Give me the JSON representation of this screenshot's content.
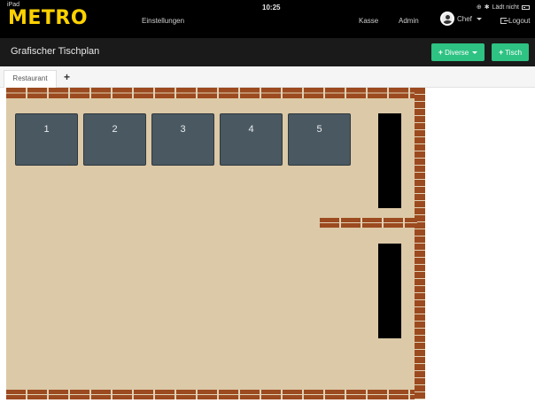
{
  "status": {
    "device": "iPad",
    "time": "10:25",
    "battery_text": "Lädt nicht"
  },
  "nav": {
    "logo": "METRO",
    "settings": "Einstellungen",
    "kasse": "Kasse",
    "admin": "Admin",
    "user": "Chef",
    "logout": "Logout"
  },
  "header": {
    "title": "Grafischer Tischplan",
    "diverse_label": "Diverse",
    "tisch_label": "Tisch"
  },
  "tabs": {
    "active": "Restaurant",
    "add": "+"
  },
  "tables": [
    "1",
    "2",
    "3",
    "4",
    "5"
  ],
  "colors": {
    "logo": "#ffd200",
    "accent_button": "#2ec283",
    "floor": "#dcc9a7",
    "brick": "#9c4a1f",
    "table": "#4a5862"
  }
}
